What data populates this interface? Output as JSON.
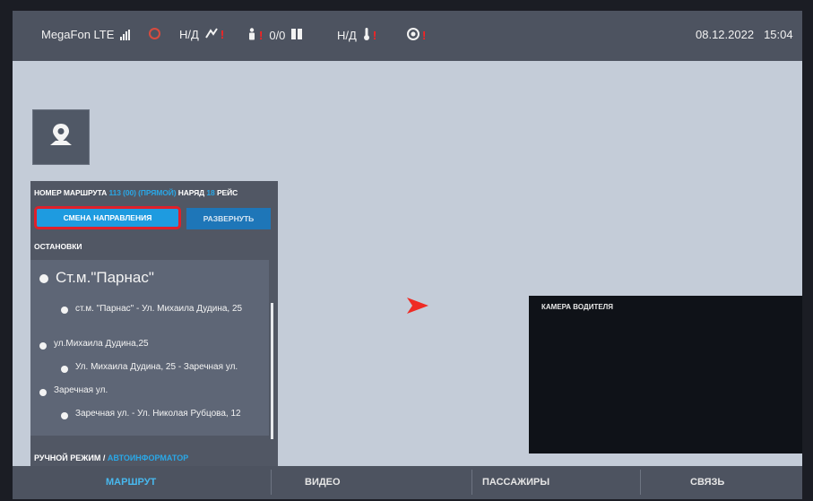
{
  "statusbar": {
    "operator": "MegaFon LTE",
    "gps_status": "Н/Д",
    "gps_alert": "!",
    "passengers_alert": "!",
    "passengers_count": "0/0",
    "temp_status": "Н/Д",
    "temp_alert": "!",
    "record_alert": "!",
    "date": "08.12.2022",
    "time": "15:04"
  },
  "route": {
    "header_prefix": "НОМЕР МАРШРУТА",
    "route_number": "113 (00) (ПРЯМОЙ)",
    "order_label": "НАРЯД",
    "order_number": "18",
    "trip_label": "РЕЙС",
    "change_direction_label": "СМЕНА НАПРАВЛЕНИЯ",
    "expand_label": "РАЗВЕРНУТЬ",
    "stops_title": "ОСТАНОВКИ"
  },
  "stops": [
    "Ст.м.\"Парнас\"",
    "ст.м. \"Парнас\" - Ул. Михаила Дудина, 25",
    "ул.Михаила Дудина,25",
    "Ул. Михаила Дудина, 25 - Заречная ул.",
    "Заречная ул.",
    "Заречная ул. - Ул. Николая Рубцова, 12"
  ],
  "mode": {
    "manual_label": "РУЧНОЙ РЕЖИМ /",
    "auto_label": "АВТОИНФОРМАТОР",
    "toggle_on": true
  },
  "camera": {
    "label": "КАМЕРА ВОДИТЕЛЯ"
  },
  "tabs": [
    "МАРШРУТ",
    "ВИДЕО",
    "ПАССАЖИРЫ",
    "СВЯЗЬ"
  ],
  "icons": {
    "signal": "signal-bars-icon",
    "globe": "globe-icon",
    "gps": "gps-off-icon",
    "passenger": "passenger-icon",
    "door": "door-icon",
    "temperature": "thermometer-icon",
    "record": "record-icon",
    "location": "location-pin-icon",
    "nav_arrow": "navigation-arrow-icon",
    "prev": "skip-back-icon",
    "play": "play-icon",
    "stop": "stop-icon",
    "next": "skip-forward-icon"
  },
  "colors": {
    "accent_blue": "#1e9be0",
    "alert_red": "#ff2020",
    "highlight_red": "#e0202a",
    "toggle_green": "#4fc23d"
  }
}
